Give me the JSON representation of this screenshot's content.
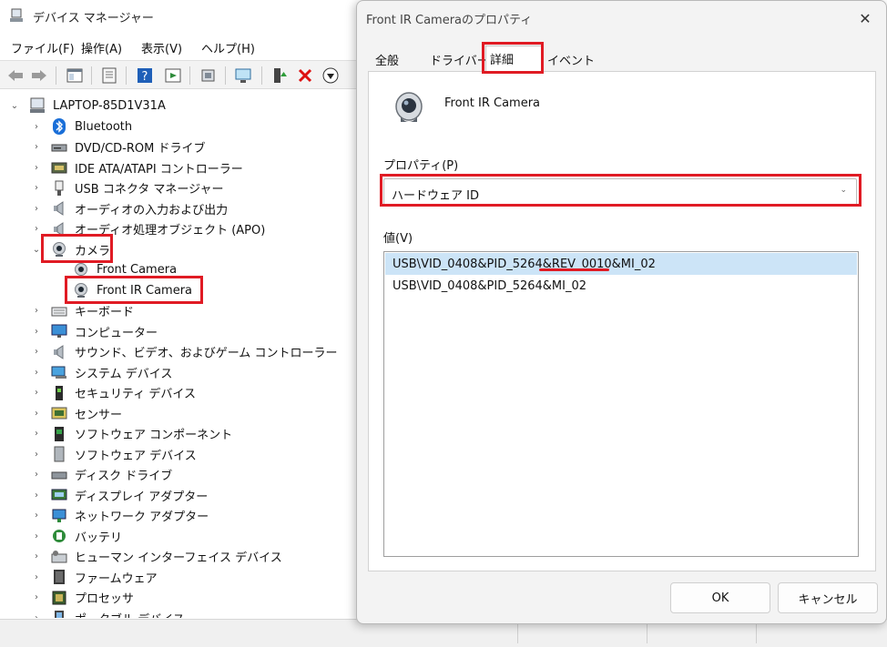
{
  "window": {
    "title": "デバイス マネージャー",
    "menu": [
      "ファイル(F)",
      "操作(A)",
      "表示(V)",
      "ヘルプ(H)"
    ]
  },
  "toolbar": {
    "icons": [
      "back-icon",
      "forward-icon",
      "properties-view-icon",
      "device-properties-icon",
      "help-icon",
      "show-hidden-icon",
      "update-driver-icon",
      "scan-hardware-icon",
      "add-driver-icon",
      "uninstall-icon",
      "download-icon"
    ]
  },
  "tree": {
    "root": "LAPTOP-85D1V31A",
    "items": [
      {
        "label": "Bluetooth",
        "icon": "bluetooth-icon",
        "expanded": false
      },
      {
        "label": "DVD/CD-ROM ドライブ",
        "icon": "dvd-drive-icon",
        "expanded": false
      },
      {
        "label": "IDE ATA/ATAPI コントローラー",
        "icon": "ide-controller-icon",
        "expanded": false
      },
      {
        "label": "USB コネクタ マネージャー",
        "icon": "usb-connector-icon",
        "expanded": false
      },
      {
        "label": "オーディオの入力および出力",
        "icon": "speaker-icon",
        "expanded": false
      },
      {
        "label": "オーディオ処理オブジェクト (APO)",
        "icon": "speaker-icon",
        "expanded": false
      },
      {
        "label": "カメラ",
        "icon": "camera-icon",
        "expanded": true,
        "children": [
          {
            "label": "Front Camera",
            "icon": "camera-icon"
          },
          {
            "label": "Front IR Camera",
            "icon": "camera-icon"
          }
        ]
      },
      {
        "label": "キーボード",
        "icon": "keyboard-icon",
        "expanded": false
      },
      {
        "label": "コンピューター",
        "icon": "monitor-icon",
        "expanded": false
      },
      {
        "label": "サウンド、ビデオ、およびゲーム コントローラー",
        "icon": "speaker-icon",
        "expanded": false
      },
      {
        "label": "システム デバイス",
        "icon": "system-device-icon",
        "expanded": false
      },
      {
        "label": "セキュリティ デバイス",
        "icon": "security-device-icon",
        "expanded": false
      },
      {
        "label": "センサー",
        "icon": "sensor-icon",
        "expanded": false
      },
      {
        "label": "ソフトウェア コンポーネント",
        "icon": "software-component-icon",
        "expanded": false
      },
      {
        "label": "ソフトウェア デバイス",
        "icon": "software-device-icon",
        "expanded": false
      },
      {
        "label": "ディスク ドライブ",
        "icon": "disk-drive-icon",
        "expanded": false
      },
      {
        "label": "ディスプレイ アダプター",
        "icon": "display-adapter-icon",
        "expanded": false
      },
      {
        "label": "ネットワーク アダプター",
        "icon": "network-adapter-icon",
        "expanded": false
      },
      {
        "label": "バッテリ",
        "icon": "battery-icon",
        "expanded": false
      },
      {
        "label": "ヒューマン インターフェイス デバイス",
        "icon": "hid-icon",
        "expanded": false
      },
      {
        "label": "ファームウェア",
        "icon": "firmware-icon",
        "expanded": false
      },
      {
        "label": "プロセッサ",
        "icon": "processor-icon",
        "expanded": false
      },
      {
        "label": "ポータブル デバイス",
        "icon": "portable-device-icon",
        "expanded": false
      }
    ]
  },
  "dialog": {
    "title": "Front IR Cameraのプロパティ",
    "tabs": [
      "全般",
      "ドライバー",
      "詳細",
      "イベント"
    ],
    "active_tab": "詳細",
    "device_name": "Front IR Camera",
    "property_label": "プロパティ(P)",
    "property_selected": "ハードウェア ID",
    "value_label": "値(V)",
    "values": [
      "USB\\VID_0408&PID_5264&REV_0010&MI_02",
      "USB\\VID_0408&PID_5264&MI_02"
    ],
    "ok_label": "OK",
    "cancel_label": "キャンセル"
  },
  "colors": {
    "annotation_red": "#e01b24",
    "selection_blue": "#cce4f7"
  }
}
